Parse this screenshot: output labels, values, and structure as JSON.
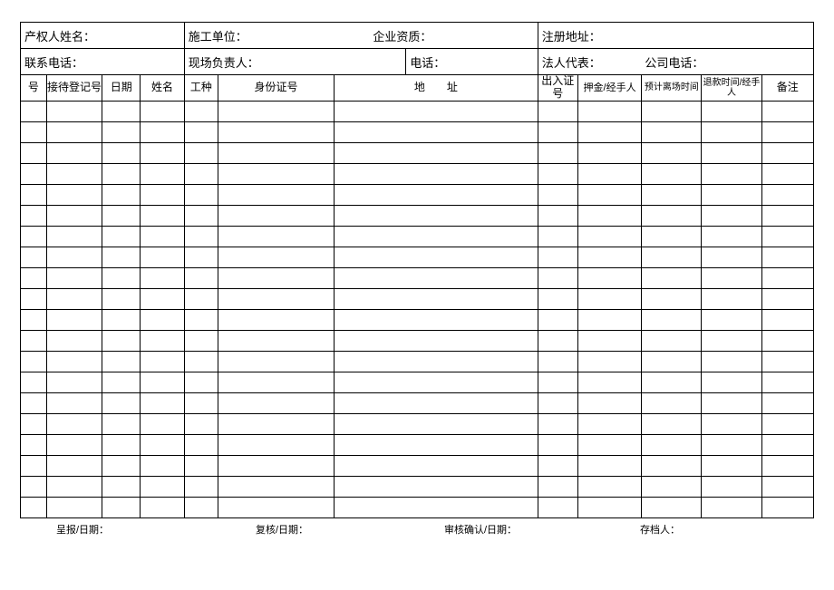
{
  "info": {
    "owner_name_label": "产权人姓名：",
    "construction_unit_label": "施工单位：",
    "enterprise_qualification_label": "企业资质：",
    "registered_address_label": "注册地址：",
    "contact_phone_label": "联系电话：",
    "site_manager_label": "现场负责人：",
    "phone_label": "电话：",
    "legal_rep_label": "法人代表：",
    "company_phone_label": "公司电话："
  },
  "columns": {
    "serial": "号",
    "reception_reg_no": "接待登记号",
    "date": "日期",
    "name": "姓名",
    "work_type": "工种",
    "id_number": "身份证号",
    "address": "地　　址",
    "pass_no": "出入证号",
    "deposit_handler": "押金/经手人",
    "est_leave_time": "预计离场时间",
    "refund_time_handler": "退款时间/经手人",
    "remarks": "备注"
  },
  "row_count": 20,
  "footer": {
    "submit_date": "呈报/日期：",
    "review_date": "复核/日期：",
    "audit_confirm_date": "审核确认/日期：",
    "archiver": "存档人："
  }
}
